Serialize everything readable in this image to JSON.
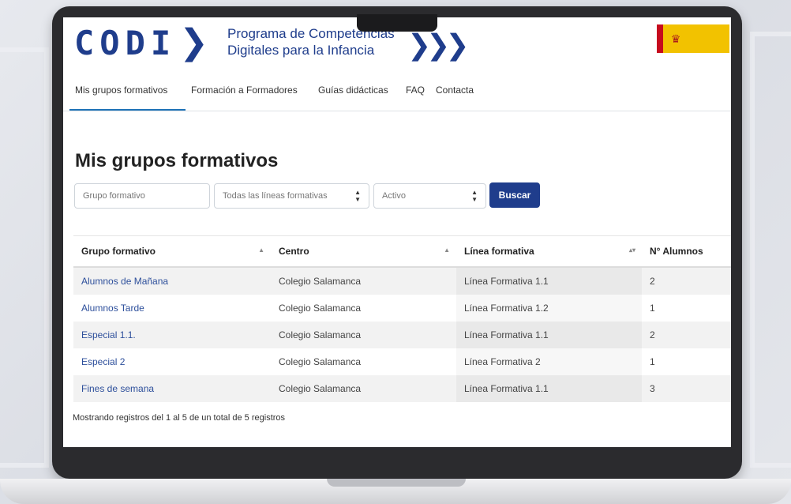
{
  "header": {
    "logo_text": "CODI",
    "subtitle_line1": "Programa de Competencias",
    "subtitle_line2": "Digitales para la Infancia"
  },
  "nav": {
    "items": [
      {
        "label": "Mis grupos formativos",
        "active": true
      },
      {
        "label": "Formación a Formadores",
        "active": false
      },
      {
        "label": "Guías didácticas",
        "active": false
      },
      {
        "label": "FAQ",
        "active": false
      },
      {
        "label": "Contacta",
        "active": false
      }
    ]
  },
  "page": {
    "title": "Mis grupos formativos"
  },
  "filters": {
    "grupo_placeholder": "Grupo formativo",
    "linea_selected": "Todas las líneas formativas",
    "estado_selected": "Activo",
    "search_label": "Buscar"
  },
  "table": {
    "headers": [
      "Grupo formativo",
      "Centro",
      "Línea formativa",
      "N° Alumnos"
    ],
    "rows": [
      [
        "Alumnos de Mañana",
        "Colegio Salamanca",
        "Línea Formativa 1.1",
        "2"
      ],
      [
        "Alumnos Tarde",
        "Colegio Salamanca",
        "Línea Formativa 1.2",
        "1"
      ],
      [
        "Especial 1.1.",
        "Colegio Salamanca",
        "Línea Formativa 1.1",
        "2"
      ],
      [
        "Especial 2",
        "Colegio Salamanca",
        "Línea Formativa 2",
        "1"
      ],
      [
        "Fines de semana",
        "Colegio Salamanca",
        "Línea Formativa 1.1",
        "3"
      ]
    ]
  },
  "footer": {
    "info": "Mostrando registros del 1 al 5 de un total de 5 registros"
  },
  "colors": {
    "brand": "#1f3d8c",
    "link": "#2d4f9b",
    "active_tab": "#1f73b7"
  }
}
